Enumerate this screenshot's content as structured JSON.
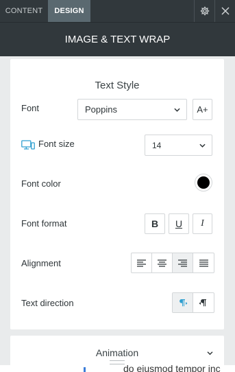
{
  "tabs": {
    "content": "CONTENT",
    "design": "DESIGN"
  },
  "toolbar": {
    "settings_icon": "gear-icon",
    "close_icon": "close-icon"
  },
  "panel": {
    "title": "IMAGE & TEXT WRAP"
  },
  "text_style": {
    "title": "Text Style",
    "font": {
      "label": "Font",
      "value": "Poppins",
      "add_button": "A+"
    },
    "font_size": {
      "label": "Font size",
      "value": "14",
      "device_icon": "desktop-mobile-icon"
    },
    "font_color": {
      "label": "Font color",
      "value": "#000000"
    },
    "font_format": {
      "label": "Font format",
      "bold": "B",
      "underline": "U",
      "italic": "I"
    },
    "alignment": {
      "label": "Alignment",
      "options": [
        "left",
        "center",
        "right",
        "justify"
      ],
      "selected": "right"
    },
    "text_direction": {
      "label": "Text direction",
      "options": [
        "ltr",
        "rtl"
      ],
      "selected": "ltr"
    }
  },
  "animation": {
    "label": "Animation"
  },
  "background": {
    "text": "do eiusmod tempor inc"
  },
  "colors": {
    "accent": "#2f9fd0",
    "header_bg": "#31383c",
    "active_tab": "#5a6970"
  }
}
